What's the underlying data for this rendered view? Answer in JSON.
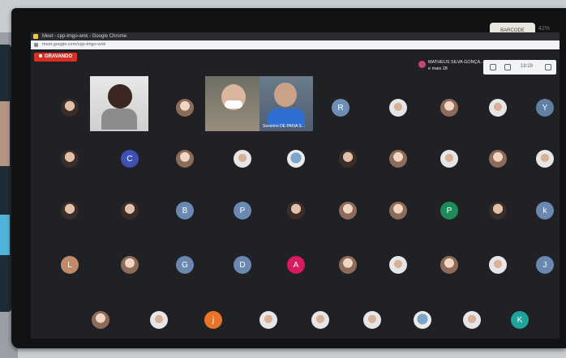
{
  "browser": {
    "title": "Meet - cpp-tmgo-wnk - Google Chrome",
    "url": "meet.google.com/cpp-tmgo-wnk"
  },
  "recording": {
    "label": "GRAVANDO"
  },
  "presenter": {
    "name": "MATHEUS SILVA GONÇA...",
    "more": "e mais 28"
  },
  "controls": {
    "time": "19:28"
  },
  "monitor": {
    "sticker": "BARCODE",
    "corner": "42%"
  },
  "video_tiles": [
    {
      "name": ""
    },
    {
      "name": ""
    },
    {
      "name": "Severino DE PAIVA S..."
    }
  ],
  "participants": [
    {
      "letter": "",
      "color": "#7c3b2f",
      "type": "photo"
    },
    {
      "letter": "",
      "color": "#6b6b6b",
      "type": "photo-b"
    },
    {
      "letter": "R",
      "color": "#6e8fb3"
    },
    {
      "letter": "",
      "color": "#555",
      "type": "photo-c"
    },
    {
      "letter": "",
      "color": "#c06b2d",
      "type": "photo-b"
    },
    {
      "letter": "",
      "color": "#777",
      "type": "photo-c"
    },
    {
      "letter": "Y",
      "color": "#5f7fa3"
    },
    {
      "letter": "",
      "color": "#444",
      "type": "photo"
    },
    {
      "letter": "C",
      "color": "#3f51b5"
    },
    {
      "letter": "",
      "color": "#b07",
      "type": "photo-b"
    },
    {
      "letter": "",
      "color": "#999",
      "type": "photo-c"
    },
    {
      "letter": "",
      "color": "#5a8fcf",
      "type": "photo-d"
    },
    {
      "letter": "",
      "color": "#888",
      "type": "photo"
    },
    {
      "letter": "",
      "color": "#d8b5a0",
      "type": "photo-b"
    },
    {
      "letter": "",
      "color": "#999",
      "type": "photo-c"
    },
    {
      "letter": "",
      "color": "#e48a2c",
      "type": "photo-b"
    },
    {
      "letter": "",
      "color": "#999",
      "type": "photo-c"
    },
    {
      "letter": "",
      "color": "#444",
      "type": "photo"
    },
    {
      "letter": "",
      "color": "#444",
      "type": "photo"
    },
    {
      "letter": "B",
      "color": "#6a88b0"
    },
    {
      "letter": "P",
      "color": "#6a88b0"
    },
    {
      "letter": "",
      "color": "#444",
      "type": "photo"
    },
    {
      "letter": "",
      "color": "#c08b5a",
      "type": "photo-b"
    },
    {
      "letter": "",
      "color": "#c08b5a",
      "type": "photo-b"
    },
    {
      "letter": "P",
      "color": "#1e8c5a"
    },
    {
      "letter": "",
      "color": "#555",
      "type": "photo"
    },
    {
      "letter": "k",
      "color": "#6a88b0"
    },
    {
      "letter": "L",
      "color": "#c08b6a"
    },
    {
      "letter": "",
      "color": "#c9a",
      "type": "photo-b"
    },
    {
      "letter": "G",
      "color": "#6a88b0"
    },
    {
      "letter": "D",
      "color": "#6a88b0"
    },
    {
      "letter": "A",
      "color": "#d81b60"
    },
    {
      "letter": "",
      "color": "#d8b5a0",
      "type": "photo-b"
    },
    {
      "letter": "",
      "color": "#999",
      "type": "photo-c"
    },
    {
      "letter": "",
      "color": "#d8b5a0",
      "type": "photo-b"
    },
    {
      "letter": "",
      "color": "#999",
      "type": "photo-c"
    },
    {
      "letter": "J",
      "color": "#6a88b0"
    },
    {
      "letter": "",
      "color": "#d8b5a0",
      "type": "photo-b"
    },
    {
      "letter": "",
      "color": "#999",
      "type": "photo-c"
    },
    {
      "letter": "j",
      "color": "#e8742a"
    },
    {
      "letter": "",
      "color": "#999",
      "type": "photo-c"
    },
    {
      "letter": "",
      "color": "#999",
      "type": "photo-c"
    },
    {
      "letter": "",
      "color": "#999",
      "type": "photo-c"
    },
    {
      "letter": "",
      "color": "#7a9",
      "type": "photo-d"
    },
    {
      "letter": "",
      "color": "#999",
      "type": "photo-c"
    },
    {
      "letter": "K",
      "color": "#1fa39a"
    }
  ]
}
